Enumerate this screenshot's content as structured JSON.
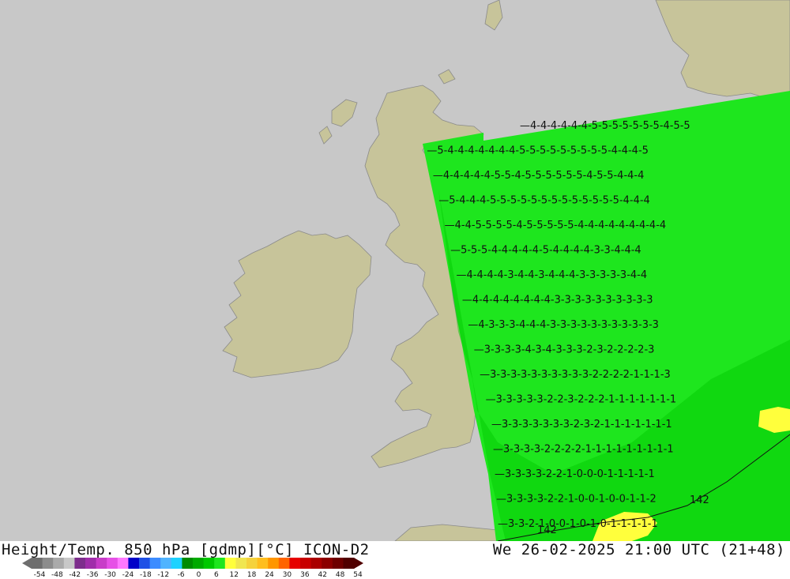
{
  "header": {
    "title_left": "Height/Temp. 850 hPa [gdmp][°C] ICON-D2",
    "title_right": "We 26-02-2025 21:00 UTC (21+48)"
  },
  "legend": {
    "ticks": [
      "-54",
      "-48",
      "-42",
      "-36",
      "-30",
      "-24",
      "-18",
      "-12",
      "-6",
      "0",
      "6",
      "12",
      "18",
      "24",
      "30",
      "36",
      "42",
      "48",
      "54"
    ],
    "colors": [
      "#6e6e6e",
      "#8c8c8c",
      "#aaaaaa",
      "#c8c8c8",
      "#7d2d8c",
      "#a02daa",
      "#c83cc8",
      "#e650e6",
      "#ff78ff",
      "#0000c8",
      "#1e50e6",
      "#3c8cff",
      "#50b4ff",
      "#1ed2ff",
      "#008c00",
      "#00aa00",
      "#00c800",
      "#1ee61e",
      "#ffff3c",
      "#f0e650",
      "#f5d23c",
      "#ffbe1e",
      "#ff9600",
      "#ff6400",
      "#e60000",
      "#c80000",
      "#aa0000",
      "#8c0000",
      "#6e0000",
      "#500000"
    ]
  },
  "map": {
    "land_color": "#c7c49a",
    "sea_color": "#c8c8c8",
    "field_color": "#1ee61e",
    "contour_label": "142",
    "rows": [
      "4-4-4-4-4-4-5-5-5-5-5-5-5-4-5-5",
      "5-4-4-4-4-4-4-4-5-5-5-5-5-5-5-5-5-4-4-4-5",
      "4-4-4-4-4-5-5-4-5-5-5-5-5-5-4-5-5-4-4-4",
      "5-4-4-4-5-5-5-5-5-5-5-5-5-5-5-5-5-4-4-4",
      "4-4-5-5-5-5-4-5-5-5-5-5-4-4-4-4-4-4-4-4-4",
      "5-5-5-4-4-4-4-4-5-4-4-4-4-3-3-4-4-4",
      "4-4-4-4-3-4-4-3-4-4-4-3-3-3-3-3-4-4",
      "4-4-4-4-4-4-4-4-3-3-3-3-3-3-3-3-3-3",
      "4-3-3-3-4-4-4-3-3-3-3-3-3-3-3-3-3-3",
      "3-3-3-3-4-3-4-3-3-3-2-3-2-2-2-2-3",
      "3-3-3-3-3-3-3-3-3-3-2-2-2-2-1-1-1-3",
      "3-3-3-3-3-2-2-3-2-2-2-1-1-1-1-1-1-1",
      "3-3-3-3-3-3-3-2-3-2-1-1-1-1-1-1-1",
      "3-3-3-3-2-2-2-2-1-1-1-1-1-1-1-1-1",
      "3-3-3-3-2-2-1-0-0-0-1-1-1-1-1",
      "3-3-3-3-2-2-1-0-0-1-0-0-1-1-2",
      "3-3-2-1-0-0-1-0-1-0-1-1-1-1-1"
    ]
  }
}
